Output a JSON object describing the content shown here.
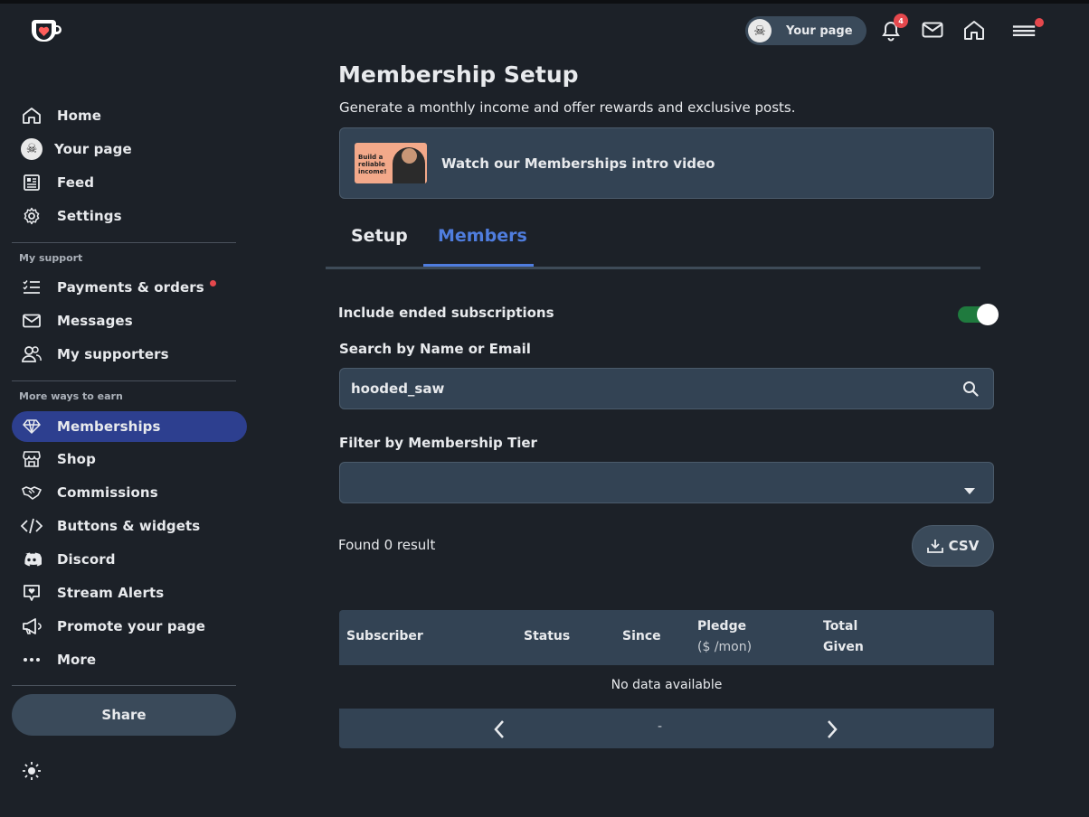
{
  "header": {
    "your_page_label": "Your page",
    "notification_count": "4"
  },
  "sidebar": {
    "items_top": [
      {
        "label": "Home",
        "icon": "home-icon"
      },
      {
        "label": "Your page",
        "icon": "avatar"
      },
      {
        "label": "Feed",
        "icon": "feed-icon"
      },
      {
        "label": "Settings",
        "icon": "gear-icon"
      }
    ],
    "section_support": "My support",
    "items_support": [
      {
        "label": "Payments & orders",
        "icon": "checklist-icon"
      },
      {
        "label": "Messages",
        "icon": "mail-icon"
      },
      {
        "label": "My supporters",
        "icon": "users-icon"
      }
    ],
    "section_earn": "More ways to earn",
    "items_earn": [
      {
        "label": "Memberships",
        "icon": "diamond-icon"
      },
      {
        "label": "Shop",
        "icon": "store-icon"
      },
      {
        "label": "Commissions",
        "icon": "handshake-icon"
      },
      {
        "label": "Buttons & widgets",
        "icon": "code-icon"
      },
      {
        "label": "Discord",
        "icon": "discord-icon"
      },
      {
        "label": "Stream Alerts",
        "icon": "stream-alert-icon"
      },
      {
        "label": "Promote your page",
        "icon": "megaphone-icon"
      },
      {
        "label": "More",
        "icon": "more-dots-icon"
      }
    ],
    "share_label": "Share"
  },
  "main": {
    "title": "Membership Setup",
    "subtitle": "Generate a monthly income and offer rewards and exclusive posts.",
    "video": {
      "label": "Watch our Memberships intro video",
      "thumb_text": "Build a reliable income!"
    },
    "tabs": [
      {
        "label": "Setup",
        "active": false
      },
      {
        "label": "Members",
        "active": true
      }
    ],
    "include_ended_label": "Include ended subscriptions",
    "include_ended_on": true,
    "search_label": "Search by Name or Email",
    "search_value": "hooded_saw",
    "filter_label": "Filter by Membership Tier",
    "filter_value": "",
    "found_text": "Found 0 result",
    "csv_label": "CSV",
    "table": {
      "columns": [
        {
          "label": "Subscriber"
        },
        {
          "label": "Status"
        },
        {
          "label": "Since"
        },
        {
          "label": "Pledge",
          "sub": "($ /mon)"
        },
        {
          "label": "Total",
          "label2": "Given"
        }
      ],
      "empty_text": "No data available",
      "page_indicator": "-"
    }
  },
  "colors": {
    "background": "#1c2128",
    "accent": "#4f7dde",
    "active_nav": "#2d3f8f",
    "toggle_on": "#1f7a3e",
    "badge": "#e5484d"
  }
}
